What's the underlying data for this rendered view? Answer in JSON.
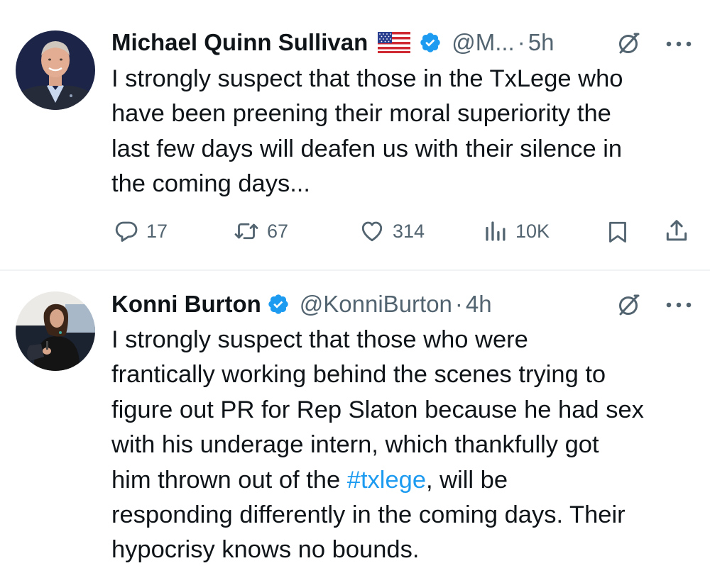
{
  "tweets": [
    {
      "author_name": "Michael Quinn Sullivan",
      "handle": "@M...",
      "separator": "·",
      "time": "5h",
      "text": "I strongly suspect that those in the TxLege who\nhave been preening their moral superiority the\nlast few days will deafen us with their silence in\nthe coming days...",
      "icons": [
        "us-flag-icon",
        "verified-badge-icon",
        "grok-icon",
        "more-icon"
      ],
      "actions": {
        "replies": "17",
        "reposts": "67",
        "likes": "314",
        "views": "10K"
      },
      "action_icons": [
        "reply-icon",
        "repost-icon",
        "like-icon",
        "views-icon",
        "bookmark-icon",
        "share-icon"
      ]
    },
    {
      "author_name": "Konni Burton",
      "handle": "@KonniBurton",
      "separator": "·",
      "time": "4h",
      "text_before": "I strongly suspect that those who were\nfrantically working behind the scenes trying to\nfigure out PR for Rep Slaton because he had sex\nwith his underage intern, which thankfully got\nhim thrown out of the ",
      "hashtag": "#txlege",
      "text_after": ", will be\nresponding differently in the coming days. Their\nhypocrisy knows no bounds.",
      "icons": [
        "verified-badge-icon",
        "grok-icon",
        "more-icon"
      ]
    }
  ],
  "colors": {
    "text": "#0f1419",
    "secondary": "#536471",
    "link": "#1d9bf0",
    "verified": "#1d9bf0",
    "divider": "#eff3f4"
  }
}
